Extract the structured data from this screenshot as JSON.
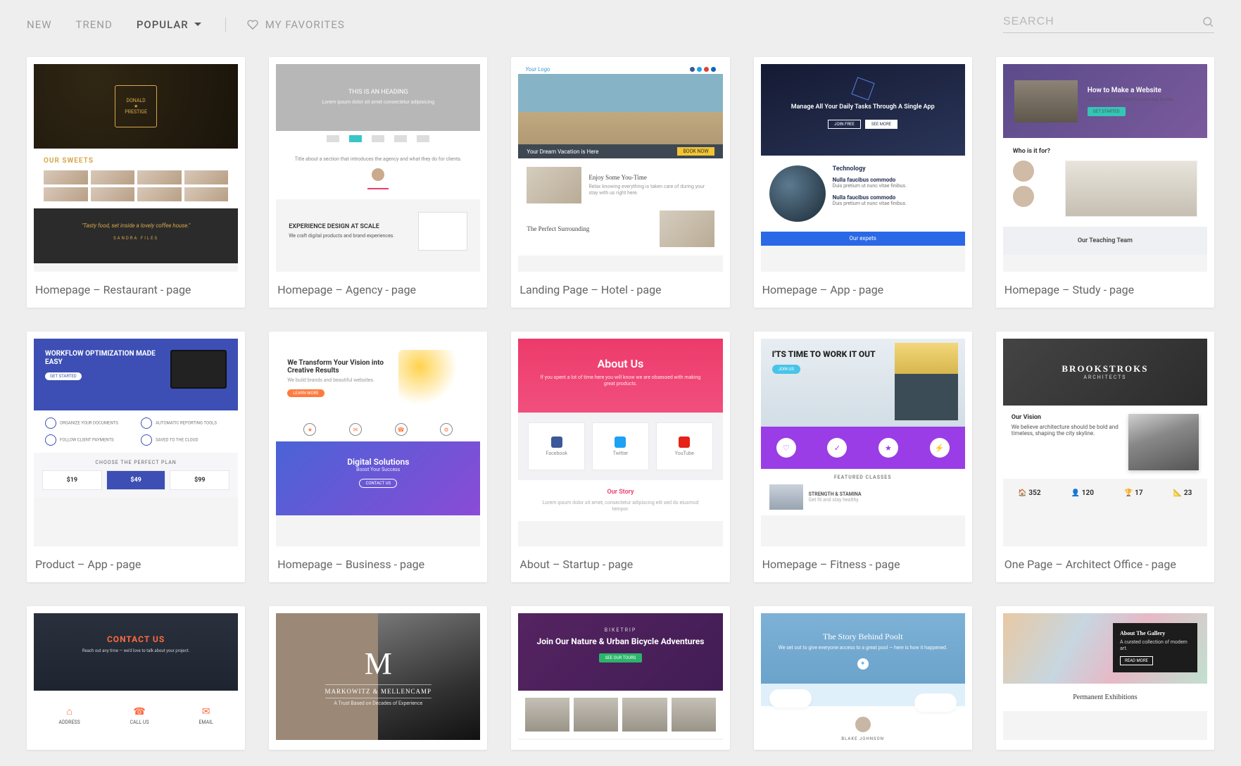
{
  "nav": {
    "new": "NEW",
    "trend": "TREND",
    "popular": "POPULAR",
    "favorites": "MY FAVORITES"
  },
  "search": {
    "placeholder": "SEARCH"
  },
  "templates": [
    {
      "title": "Homepage – Restaurant - page"
    },
    {
      "title": "Homepage – Agency - page"
    },
    {
      "title": "Landing Page – Hotel - page"
    },
    {
      "title": "Homepage – App - page"
    },
    {
      "title": "Homepage – Study - page"
    },
    {
      "title": "Product – App - page"
    },
    {
      "title": "Homepage – Business - page"
    },
    {
      "title": "About – Startup - page"
    },
    {
      "title": "Homepage – Fitness - page"
    },
    {
      "title": "One Page – Architect Office - page"
    },
    {
      "title": ""
    },
    {
      "title": ""
    },
    {
      "title": ""
    },
    {
      "title": ""
    },
    {
      "title": ""
    }
  ],
  "thumbs": {
    "restaurant": {
      "heading": "OUR SWEETS",
      "quote": "\"Tasty food, set inside a lovely coffee house.\""
    },
    "agency": {
      "hero": "THIS IS AN HEADING",
      "sub": "Lorem ipsum dolor sit amet consectetur adipisicing",
      "exp_title": "EXPERIENCE DESIGN AT SCALE"
    },
    "hotel": {
      "logo": "Your Logo",
      "caption": "Your Dream Vacation is Here",
      "enjoy": "Enjoy Some You-Time",
      "surround": "The Perfect Surrounding"
    },
    "app": {
      "hero": "Manage All Your Daily Tasks Through A Single App",
      "btn1": "JOIN FREE",
      "btn2": "SEE MORE",
      "section": "Technology",
      "footer": "Our expets"
    },
    "study": {
      "title": "How to Make a Website",
      "who": "Who is it for?",
      "team": "Our Teaching Team"
    },
    "product": {
      "title": "WORKFLOW OPTIMIZATION MADE EASY",
      "plan": "CHOOSE THE PERFECT PLAN",
      "p1": "$19",
      "p2": "$49",
      "p3": "$99"
    },
    "business": {
      "title": "We Transform Your Vision into Creative Results",
      "digital": "Digital Solutions",
      "boost": "Boost Your Success"
    },
    "startup": {
      "title": "About Us",
      "fb": "Facebook",
      "tw": "Twitter",
      "yt": "YouTube",
      "story": "Our Story"
    },
    "fitness": {
      "title": "I'TS TIME TO WORK IT OUT",
      "classes": "FEATURED CLASSES",
      "c1": "STRENGTH & STAMINA"
    },
    "architect": {
      "brand": "BROOKSTROKS",
      "vision": "Our Vision",
      "s1": "352",
      "s2": "120",
      "s3": "17",
      "s4": "23"
    },
    "contact": {
      "title": "CONTACT US",
      "a": "ADDRESS",
      "b": "CALL US",
      "c": "EMAIL"
    },
    "markowitz": {
      "letter": "M",
      "name": "MARKOWITZ & MELLENCAMP"
    },
    "bicycle": {
      "title": "Join Our Nature & Urban Bicycle Adventures"
    },
    "story": {
      "title": "The Story Behind Poolt",
      "name": "BLAKE JOHNSON"
    },
    "gallery": {
      "box": "About The Gallery",
      "footer": "Permanent Exhibitions"
    }
  }
}
